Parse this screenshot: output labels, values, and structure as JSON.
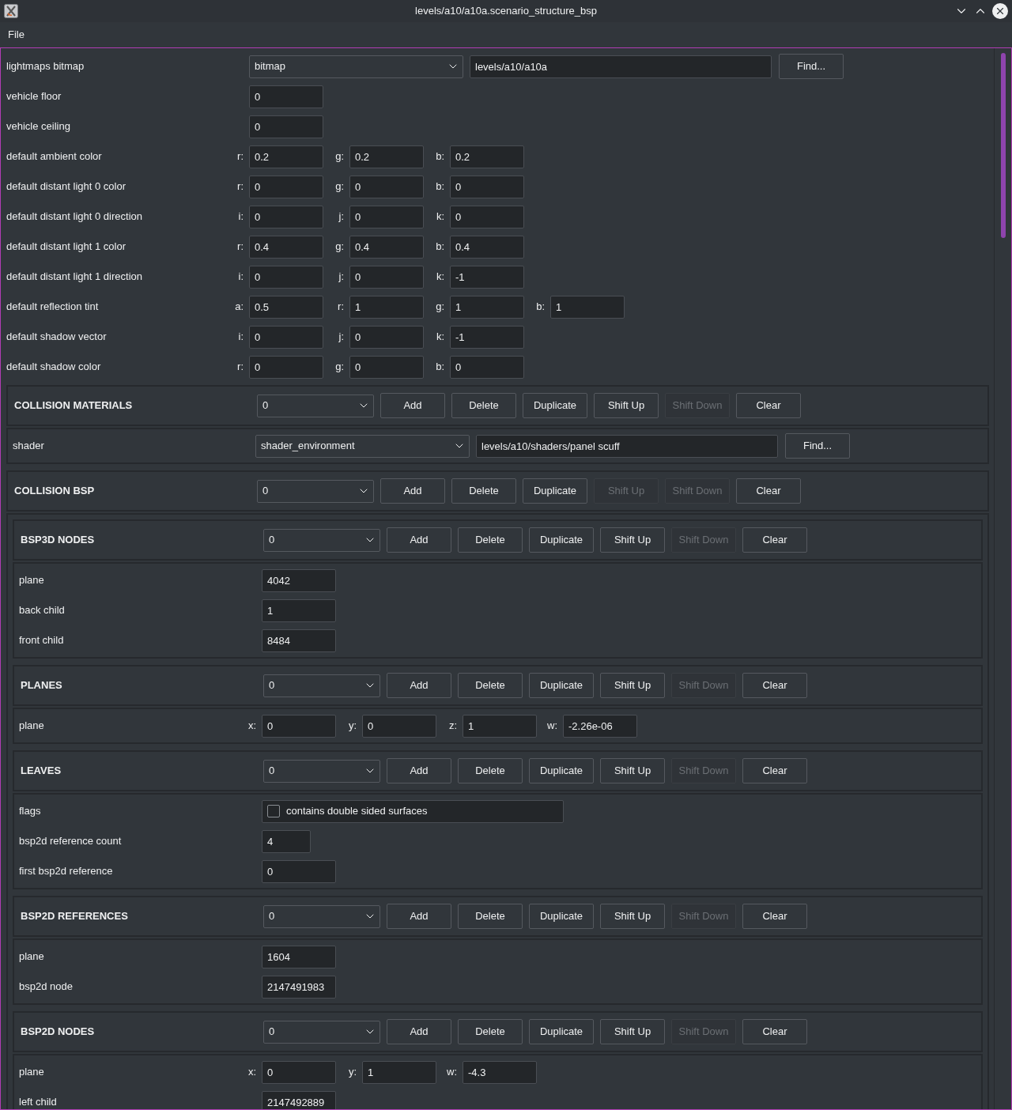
{
  "window": {
    "title": "levels/a10/a10a.scenario_structure_bsp"
  },
  "menu": [
    "File"
  ],
  "fields": [
    {
      "label": "lightmaps bitmap",
      "kind": "tagref",
      "class": "bitmap",
      "path": "levels/a10/a10a",
      "button": "Find..."
    },
    {
      "label": "vehicle floor",
      "kind": "number",
      "value": "0"
    },
    {
      "label": "vehicle ceiling",
      "kind": "number",
      "value": "0"
    },
    {
      "label": "default ambient color",
      "kind": "vector",
      "components": [
        {
          "axis": "r:",
          "value": "0.2"
        },
        {
          "axis": "g:",
          "value": "0.2"
        },
        {
          "axis": "b:",
          "value": "0.2"
        }
      ]
    },
    {
      "label": "default distant light 0 color",
      "kind": "vector",
      "components": [
        {
          "axis": "r:",
          "value": "0"
        },
        {
          "axis": "g:",
          "value": "0"
        },
        {
          "axis": "b:",
          "value": "0"
        }
      ]
    },
    {
      "label": "default distant light 0 direction",
      "kind": "vector",
      "components": [
        {
          "axis": "i:",
          "value": "0"
        },
        {
          "axis": "j:",
          "value": "0"
        },
        {
          "axis": "k:",
          "value": "0"
        }
      ]
    },
    {
      "label": "default distant light 1 color",
      "kind": "vector",
      "components": [
        {
          "axis": "r:",
          "value": "0.4"
        },
        {
          "axis": "g:",
          "value": "0.4"
        },
        {
          "axis": "b:",
          "value": "0.4"
        }
      ]
    },
    {
      "label": "default distant light 1 direction",
      "kind": "vector",
      "components": [
        {
          "axis": "i:",
          "value": "0"
        },
        {
          "axis": "j:",
          "value": "0"
        },
        {
          "axis": "k:",
          "value": "-1"
        }
      ]
    },
    {
      "label": "default reflection tint",
      "kind": "vector",
      "components": [
        {
          "axis": "a:",
          "value": "0.5"
        },
        {
          "axis": "r:",
          "value": "1"
        },
        {
          "axis": "g:",
          "value": "1"
        },
        {
          "axis": "b:",
          "value": "1"
        }
      ]
    },
    {
      "label": "default shadow vector",
      "kind": "vector",
      "components": [
        {
          "axis": "i:",
          "value": "0"
        },
        {
          "axis": "j:",
          "value": "0"
        },
        {
          "axis": "k:",
          "value": "-1"
        }
      ]
    },
    {
      "label": "default shadow color",
      "kind": "vector",
      "components": [
        {
          "axis": "r:",
          "value": "0"
        },
        {
          "axis": "g:",
          "value": "0"
        },
        {
          "axis": "b:",
          "value": "0"
        }
      ]
    }
  ],
  "blocks": [
    {
      "title": "COLLISION MATERIALS",
      "index": "0",
      "buttons": [
        {
          "label": "Add",
          "disabled": false
        },
        {
          "label": "Delete",
          "disabled": false
        },
        {
          "label": "Duplicate",
          "disabled": false
        },
        {
          "label": "Shift Up",
          "disabled": false
        },
        {
          "label": "Shift Down",
          "disabled": true
        },
        {
          "label": "Clear",
          "disabled": false
        }
      ],
      "fields": [
        {
          "label": "shader",
          "kind": "tagref",
          "class": "shader_environment",
          "path": "levels/a10/shaders/panel scuff",
          "button": "Find..."
        }
      ]
    },
    {
      "title": "COLLISION BSP",
      "index": "0",
      "buttons": [
        {
          "label": "Add",
          "disabled": false
        },
        {
          "label": "Delete",
          "disabled": false
        },
        {
          "label": "Duplicate",
          "disabled": false
        },
        {
          "label": "Shift Up",
          "disabled": true
        },
        {
          "label": "Shift Down",
          "disabled": true
        },
        {
          "label": "Clear",
          "disabled": false
        }
      ],
      "children": [
        {
          "title": "BSP3D NODES",
          "index": "0",
          "buttons": [
            {
              "label": "Add",
              "disabled": false
            },
            {
              "label": "Delete",
              "disabled": false
            },
            {
              "label": "Duplicate",
              "disabled": false
            },
            {
              "label": "Shift Up",
              "disabled": false
            },
            {
              "label": "Shift Down",
              "disabled": true
            },
            {
              "label": "Clear",
              "disabled": false
            }
          ],
          "fields": [
            {
              "label": "plane",
              "kind": "number",
              "value": "4042"
            },
            {
              "label": "back child",
              "kind": "number",
              "value": "1"
            },
            {
              "label": "front child",
              "kind": "number",
              "value": "8484"
            }
          ]
        },
        {
          "title": "PLANES",
          "index": "0",
          "buttons": [
            {
              "label": "Add",
              "disabled": false
            },
            {
              "label": "Delete",
              "disabled": false
            },
            {
              "label": "Duplicate",
              "disabled": false
            },
            {
              "label": "Shift Up",
              "disabled": false
            },
            {
              "label": "Shift Down",
              "disabled": true
            },
            {
              "label": "Clear",
              "disabled": false
            }
          ],
          "fields": [
            {
              "label": "plane",
              "kind": "vector",
              "components": [
                {
                  "axis": "x:",
                  "value": "0"
                },
                {
                  "axis": "y:",
                  "value": "0"
                },
                {
                  "axis": "z:",
                  "value": "1"
                },
                {
                  "axis": "w:",
                  "value": "-2.26e-06"
                }
              ]
            }
          ]
        },
        {
          "title": "LEAVES",
          "index": "0",
          "buttons": [
            {
              "label": "Add",
              "disabled": false
            },
            {
              "label": "Delete",
              "disabled": false
            },
            {
              "label": "Duplicate",
              "disabled": false
            },
            {
              "label": "Shift Up",
              "disabled": false
            },
            {
              "label": "Shift Down",
              "disabled": true
            },
            {
              "label": "Clear",
              "disabled": false
            }
          ],
          "fields": [
            {
              "label": "flags",
              "kind": "flags",
              "options": [
                {
                  "label": "contains double sided surfaces",
                  "checked": false
                }
              ]
            },
            {
              "label": "bsp2d reference count",
              "kind": "short",
              "value": "4"
            },
            {
              "label": "first bsp2d reference",
              "kind": "number",
              "value": "0"
            }
          ]
        },
        {
          "title": "BSP2D REFERENCES",
          "index": "0",
          "buttons": [
            {
              "label": "Add",
              "disabled": false
            },
            {
              "label": "Delete",
              "disabled": false
            },
            {
              "label": "Duplicate",
              "disabled": false
            },
            {
              "label": "Shift Up",
              "disabled": false
            },
            {
              "label": "Shift Down",
              "disabled": true
            },
            {
              "label": "Clear",
              "disabled": false
            }
          ],
          "fields": [
            {
              "label": "plane",
              "kind": "number",
              "value": "1604"
            },
            {
              "label": "bsp2d node",
              "kind": "number",
              "value": "2147491983"
            }
          ]
        },
        {
          "title": "BSP2D NODES",
          "index": "0",
          "buttons": [
            {
              "label": "Add",
              "disabled": false
            },
            {
              "label": "Delete",
              "disabled": false
            },
            {
              "label": "Duplicate",
              "disabled": false
            },
            {
              "label": "Shift Up",
              "disabled": false
            },
            {
              "label": "Shift Down",
              "disabled": true
            },
            {
              "label": "Clear",
              "disabled": false
            }
          ],
          "fields": [
            {
              "label": "plane",
              "kind": "vector",
              "components": [
                {
                  "axis": "x:",
                  "value": "0"
                },
                {
                  "axis": "y:",
                  "value": "1"
                },
                {
                  "axis": "w:",
                  "value": "-4.3"
                }
              ]
            },
            {
              "label": "left child",
              "kind": "number",
              "value": "2147492889"
            }
          ]
        }
      ]
    }
  ]
}
